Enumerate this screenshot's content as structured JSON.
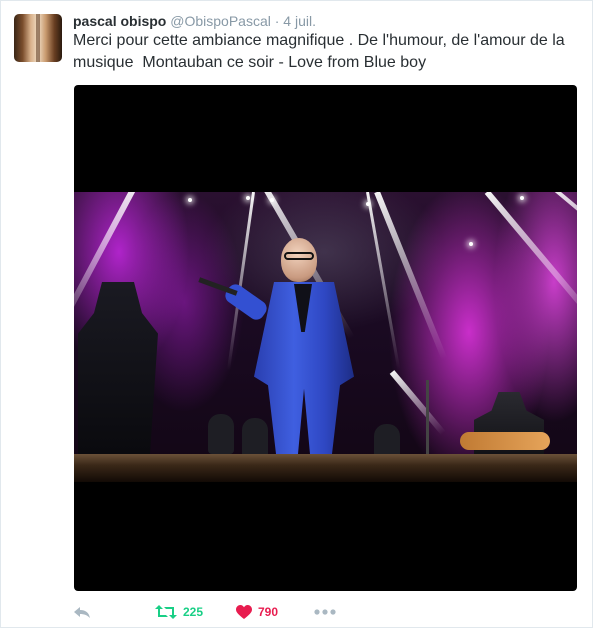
{
  "tweet": {
    "author_name": "pascal obispo",
    "handle": "@ObispoPascal",
    "separator": "·",
    "date": "4 juil.",
    "text_line1": "Merci pour cette ambiance magnifique . De l'humour, de l'amour de la",
    "text_line2": "musique  Montauban ce soir - Love from Blue boy"
  },
  "actions": {
    "reply_icon": "reply-icon",
    "retweet_icon": "retweet-icon",
    "retweet_count": "225",
    "like_icon": "heart-icon",
    "like_count": "790",
    "more_icon": "more-dots-icon"
  },
  "colors": {
    "retweet": "#19cf86",
    "like": "#e81c4f",
    "muted": "#8899a6",
    "text": "#292f33"
  }
}
